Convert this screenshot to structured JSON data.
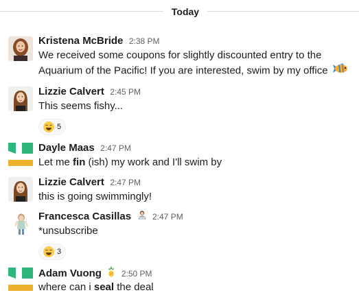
{
  "divider": {
    "label": "Today"
  },
  "messages": [
    {
      "name": "Kristena McBride",
      "time": "2:38 PM",
      "text": "We received some coupons for slightly discounted entry to the Aquarium of the Pacific! If you are interested, swim by my office",
      "inline_emoji": "tropical-fish"
    },
    {
      "name": "Lizzie Calvert",
      "time": "2:45 PM",
      "text": "This seems fishy...",
      "reaction": {
        "emoji": "joy",
        "count": "5"
      }
    },
    {
      "name": "Dayle Maas",
      "time": "2:47 PM",
      "text_before": "Let me ",
      "text_bold": "fin",
      "text_after": " (ish) my work and I'll swim by"
    },
    {
      "name": "Lizzie Calvert",
      "time": "2:47 PM",
      "text": "this is going swimmingly!"
    },
    {
      "name": "Francesca Casillas",
      "status_emoji": "person-in-laptop",
      "time": "2:47 PM",
      "text": "*unsubscribe",
      "reaction": {
        "emoji": "joy",
        "count": "3"
      }
    },
    {
      "name": "Adam Vuong",
      "status_emoji": "pineapple",
      "time": "2:50 PM",
      "text_before": "where can i ",
      "text_bold": "seal",
      "text_after": " the deal"
    }
  ],
  "colors": {
    "slack_green": "#2eb67d",
    "slack_yellow": "#ecb22e",
    "reaction_bg": "#f8f8f8",
    "time_text": "#616061"
  }
}
